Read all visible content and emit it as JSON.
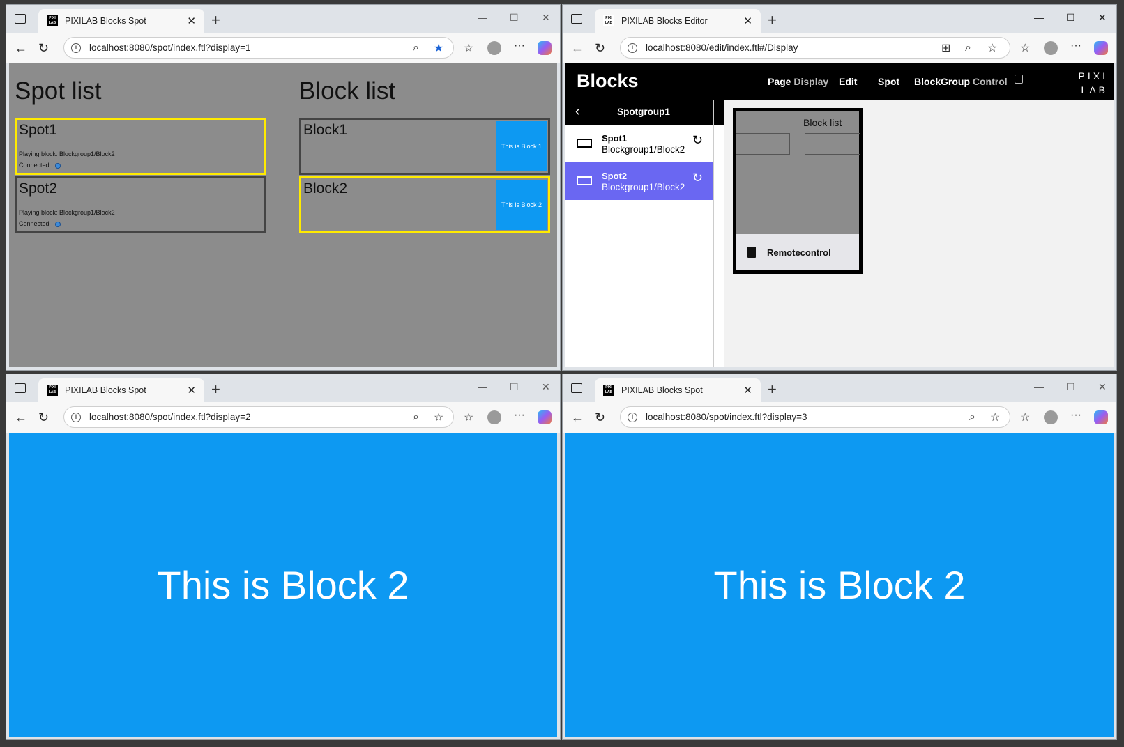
{
  "windows": [
    {
      "id": "spot1",
      "tab_title": "PIXILAB Blocks Spot",
      "url": "localhost:8080/spot/index.ftl?display=1",
      "spot_list_title": "Spot list",
      "block_list_title": "Block list",
      "spots": [
        {
          "name": "Spot1",
          "playing": "Playing block: Blockgroup1/Block2",
          "status": "Connected"
        },
        {
          "name": "Spot2",
          "playing": "Playing block: Blockgroup1/Block2",
          "status": "Connected"
        }
      ],
      "blocks": [
        {
          "name": "Block1",
          "thumb": "This is Block 1"
        },
        {
          "name": "Block2",
          "thumb": "This is Block 2"
        }
      ]
    },
    {
      "id": "editor",
      "tab_title": "PIXILAB Blocks Editor",
      "url": "localhost:8080/edit/index.ftl#/Display",
      "logo": "Blocks",
      "nav": {
        "page": "Page",
        "display": "Display",
        "edit": "Edit",
        "spot": "Spot",
        "block": "Block",
        "group": "Group",
        "control": "Control"
      },
      "brand_line1": "PIXI",
      "brand_line2": "LAB",
      "group_title": "Spotgroup1",
      "spot_items": [
        {
          "name": "Spot1",
          "block": "Blockgroup1/Block2"
        },
        {
          "name": "Spot2",
          "block": "Blockgroup1/Block2"
        }
      ],
      "preview_block_list": "Block list",
      "preview_remote": "Remotecontrol"
    },
    {
      "id": "spot2",
      "tab_title": "PIXILAB Blocks Spot",
      "url": "localhost:8080/spot/index.ftl?display=2",
      "content_text": "This is Block 2"
    },
    {
      "id": "spot3",
      "tab_title": "PIXILAB Blocks Spot",
      "url": "localhost:8080/spot/index.ftl?display=3",
      "content_text": "This is Block 2"
    }
  ],
  "colors": {
    "spot_bg": "#8c8c8c",
    "block_blue": "#0d99f2",
    "selected_yellow": "#ffeb00",
    "active_item": "#6a67f2"
  },
  "favicon_text": "PIXI LAB"
}
